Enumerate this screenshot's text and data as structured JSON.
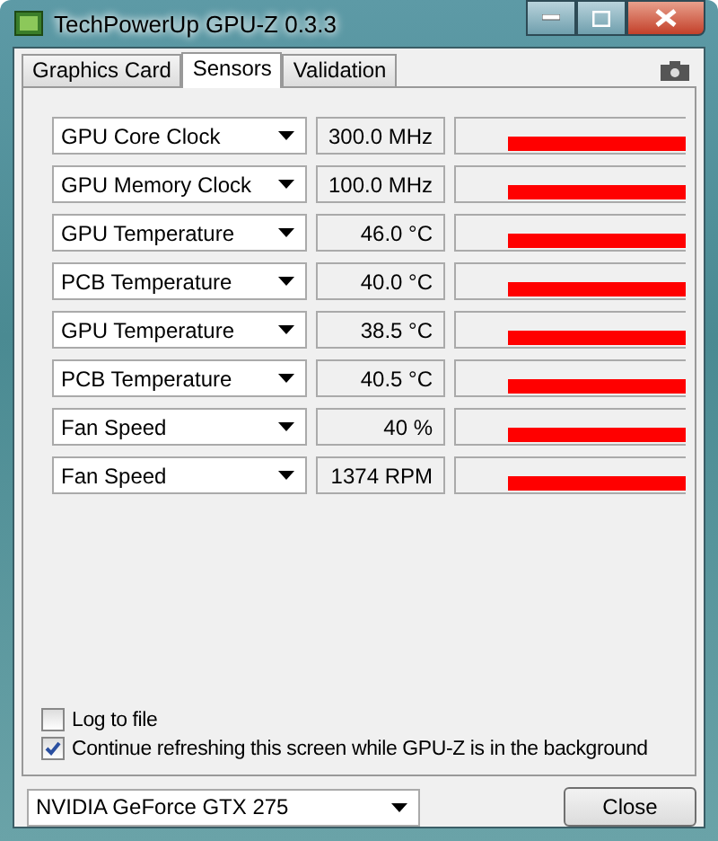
{
  "window": {
    "title": "TechPowerUp GPU-Z 0.3.3"
  },
  "tabs": [
    {
      "label": "Graphics Card",
      "selected": false
    },
    {
      "label": "Sensors",
      "selected": true
    },
    {
      "label": "Validation",
      "selected": false
    }
  ],
  "sensors": [
    {
      "name": "GPU Core Clock",
      "reading": "300.0 MHz"
    },
    {
      "name": "GPU Memory Clock",
      "reading": "100.0 MHz"
    },
    {
      "name": "GPU Temperature",
      "reading": "46.0 °C"
    },
    {
      "name": "PCB Temperature",
      "reading": "40.0 °C"
    },
    {
      "name": "GPU Temperature",
      "reading": "38.5 °C"
    },
    {
      "name": "PCB Temperature",
      "reading": "40.5 °C"
    },
    {
      "name": "Fan Speed",
      "reading": "40 %"
    },
    {
      "name": "Fan Speed",
      "reading": "1374 RPM"
    }
  ],
  "options": [
    {
      "label": "Log to file",
      "checked": false
    },
    {
      "label": "Continue refreshing this screen while GPU-Z is in the background",
      "checked": true
    }
  ],
  "card_select": {
    "value": "NVIDIA GeForce GTX 275"
  },
  "buttons": [
    {
      "label": "Close"
    }
  ]
}
